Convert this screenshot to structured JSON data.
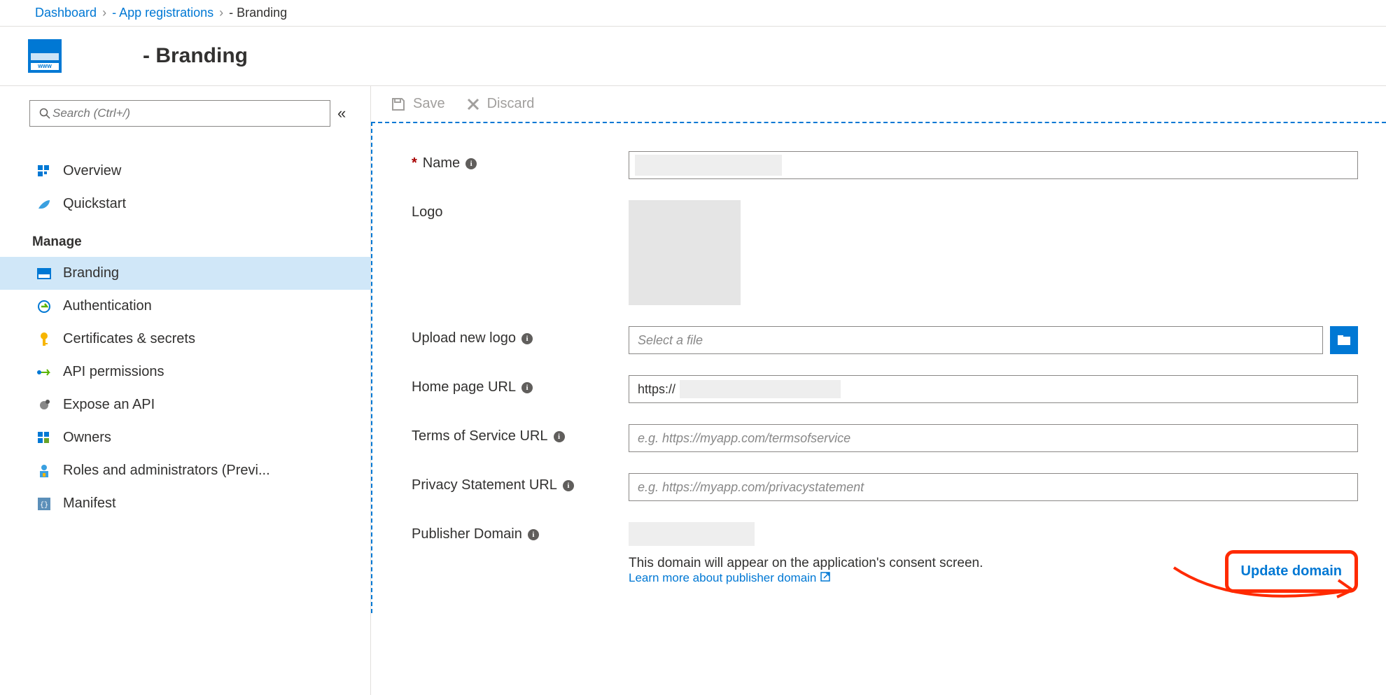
{
  "breadcrumb": {
    "dashboard": "Dashboard",
    "app_registrations": "- App registrations",
    "current": "- Branding"
  },
  "page_title": "- Branding",
  "sidebar": {
    "search_placeholder": "Search (Ctrl+/)",
    "items": {
      "overview": "Overview",
      "quickstart": "Quickstart"
    },
    "manage_label": "Manage",
    "manage_items": {
      "branding": "Branding",
      "authentication": "Authentication",
      "certificates": "Certificates & secrets",
      "api_permissions": "API permissions",
      "expose_api": "Expose an API",
      "owners": "Owners",
      "roles": "Roles and administrators (Previ...",
      "manifest": "Manifest"
    }
  },
  "toolbar": {
    "save": "Save",
    "discard": "Discard"
  },
  "form": {
    "name_label": "Name",
    "logo_label": "Logo",
    "upload_label": "Upload new logo",
    "upload_placeholder": "Select a file",
    "homepage_label": "Home page URL",
    "homepage_value": "https://",
    "tos_label": "Terms of Service URL",
    "tos_placeholder": "e.g. https://myapp.com/termsofservice",
    "privacy_label": "Privacy Statement URL",
    "privacy_placeholder": "e.g. https://myapp.com/privacystatement",
    "publisher_label": "Publisher Domain",
    "update_domain": "Update domain",
    "consent_note": "This domain will appear on the application's consent screen.",
    "learn_more": "Learn more about publisher domain"
  }
}
